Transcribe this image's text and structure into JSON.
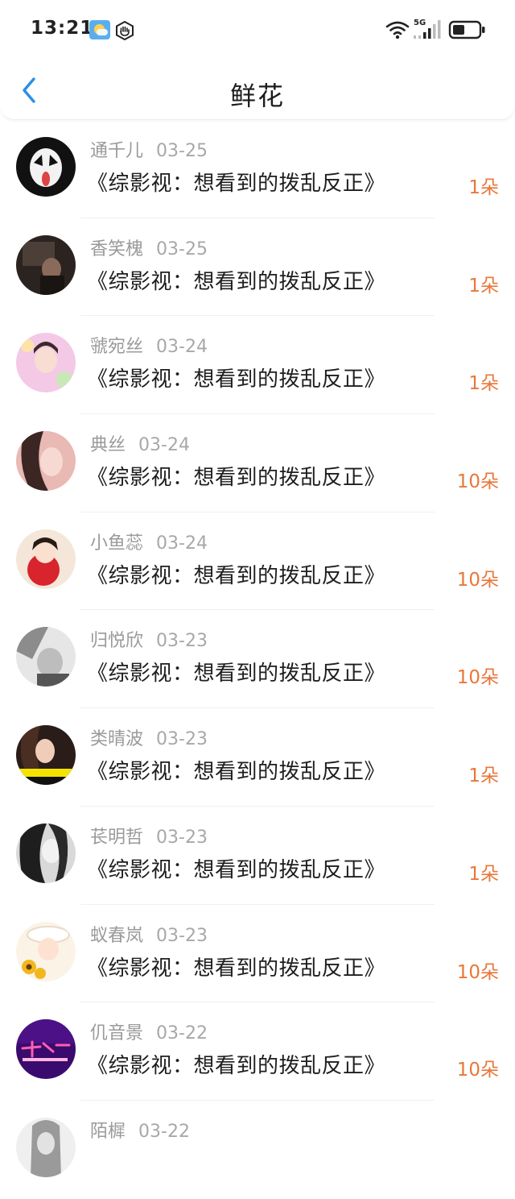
{
  "status_bar": {
    "time": "13:21",
    "network_label": "5G"
  },
  "header": {
    "title": "鲜花"
  },
  "colors": {
    "accent": "#2a8ee8",
    "count": "#e8773a"
  },
  "items": [
    {
      "name": "通千儿",
      "date": "03-25",
      "book": "《综影视：想看到的拨乱反正》",
      "count": "1朵"
    },
    {
      "name": "香笑槐",
      "date": "03-25",
      "book": "《综影视：想看到的拨乱反正》",
      "count": "1朵"
    },
    {
      "name": "虢宛丝",
      "date": "03-24",
      "book": "《综影视：想看到的拨乱反正》",
      "count": "1朵"
    },
    {
      "name": "典丝",
      "date": "03-24",
      "book": "《综影视：想看到的拨乱反正》",
      "count": "10朵"
    },
    {
      "name": "小鱼蕊",
      "date": "03-24",
      "book": "《综影视：想看到的拨乱反正》",
      "count": "10朵"
    },
    {
      "name": "归悦欣",
      "date": "03-23",
      "book": "《综影视：想看到的拨乱反正》",
      "count": "10朵"
    },
    {
      "name": "类晴波",
      "date": "03-23",
      "book": "《综影视：想看到的拨乱反正》",
      "count": "1朵"
    },
    {
      "name": "苌明哲",
      "date": "03-23",
      "book": "《综影视：想看到的拨乱反正》",
      "count": "1朵"
    },
    {
      "name": "蚁春岚",
      "date": "03-23",
      "book": "《综影视：想看到的拨乱反正》",
      "count": "10朵"
    },
    {
      "name": "仉音景",
      "date": "03-22",
      "book": "《综影视：想看到的拨乱反正》",
      "count": "10朵"
    },
    {
      "name": "陌樨",
      "date": "03-22",
      "book": "",
      "count": ""
    }
  ]
}
